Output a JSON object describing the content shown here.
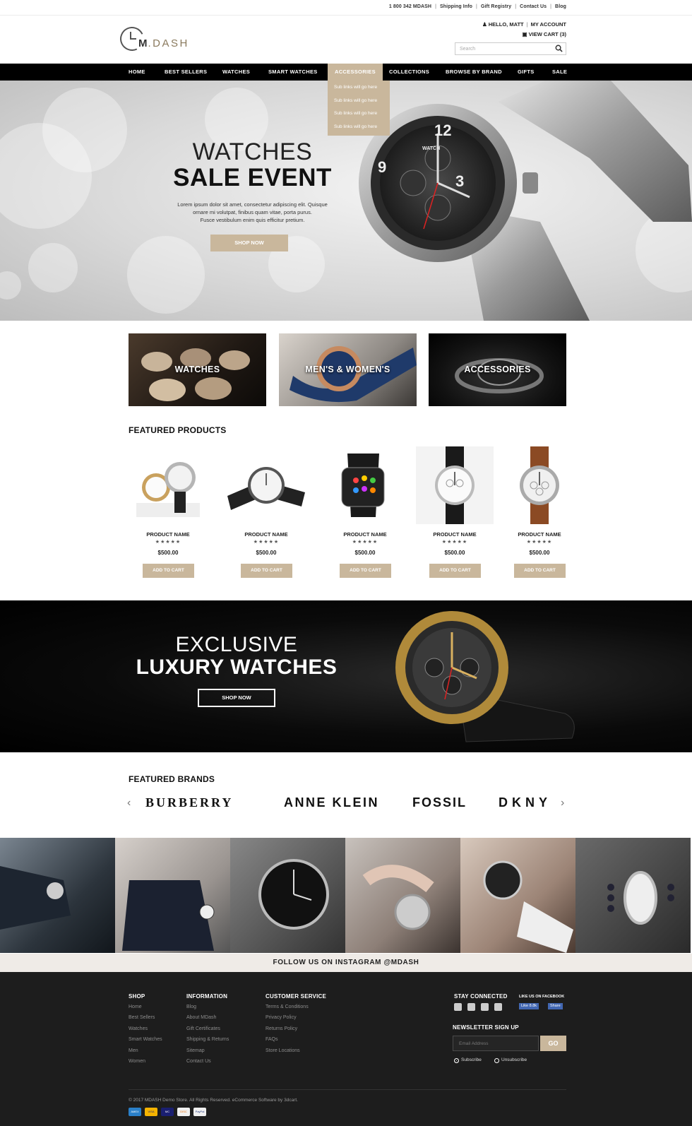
{
  "topbar": {
    "links": [
      "1 800 342 MDASH",
      "Shipping Info",
      "Gift Registry",
      "Contact Us",
      "Blog"
    ]
  },
  "header": {
    "logo_prefix": "M",
    "logo_suffix": ".DASH",
    "greeting": "HELLO, MATT",
    "my_account": "MY ACCOUNT",
    "view_cart": "VIEW CART (3)",
    "search_placeholder": "Search"
  },
  "nav": {
    "items": [
      "HOME",
      "BEST SELLERS",
      "WATCHES",
      "SMART WATCHES",
      "ACCESSORIES",
      "COLLECTIONS",
      "BROWSE BY BRAND",
      "GIFTS",
      "SALE"
    ],
    "active": "ACCESSORIES",
    "dropdown": [
      "Sub links will go here",
      "Sub links will go here",
      "Sub links will go here",
      "Sub links will go here"
    ]
  },
  "hero": {
    "line1": "WATCHES",
    "line2": "SALE EVENT",
    "desc1": "Lorem ipsum dolor sit amet, consectetur adipiscing elit. Quisque",
    "desc2": "ornare mi volutpat, finibus quam vitae, porta purus.",
    "desc3": "Fusce vestibulum enim quis efficitur pretium.",
    "button": "SHOP NOW",
    "watch_face_text": "WATCH"
  },
  "categories": [
    "WATCHES",
    "MEN'S & WOMEN'S",
    "ACCESSORIES"
  ],
  "featured": {
    "title": "FEATURED PRODUCTS",
    "products": [
      {
        "name": "PRODUCT NAME",
        "stars": "★★★★★",
        "price": "$500.00",
        "button": "ADD TO CART"
      },
      {
        "name": "PRODUCT NAME",
        "stars": "★★★★★",
        "price": "$500.00",
        "button": "ADD TO CART"
      },
      {
        "name": "PRODUCT NAME",
        "stars": "★★★★★",
        "price": "$500.00",
        "button": "ADD TO CART"
      },
      {
        "name": "PRODUCT NAME",
        "stars": "★★★★★",
        "price": "$500.00",
        "button": "ADD TO CART"
      },
      {
        "name": "PRODUCT NAME",
        "stars": "★★★★★",
        "price": "$500.00",
        "button": "ADD TO CART"
      }
    ]
  },
  "luxury": {
    "line1": "EXCLUSIVE",
    "line2": "LUXURY WATCHES",
    "button": "SHOP NOW"
  },
  "brands": {
    "title": "FEATURED BRANDS",
    "items": [
      "BURBERRY",
      "ANNE KLEIN",
      "FOSSIL",
      "DKNY"
    ]
  },
  "instagram": {
    "label": "FOLLOW US ON INSTAGRAM @MDASH"
  },
  "footer": {
    "shop": {
      "title": "SHOP",
      "items": [
        "Home",
        "Best Sellers",
        "Watches",
        "Smart Watches",
        "Men",
        "Women"
      ]
    },
    "information": {
      "title": "INFORMATION",
      "items": [
        "Blog",
        "About MDash",
        "Gift Certificates",
        "Shipping & Returns",
        "Sitemap",
        "Contact Us"
      ]
    },
    "service": {
      "title": "CUSTOMER SERVICE",
      "items": [
        "Terms & Conditions",
        "Privacy Policy",
        "Returns Policy",
        "FAQs",
        "Store Locations"
      ]
    },
    "stay_connected": "STAY CONNECTED",
    "like_us": "LIKE US ON FACEBOOK",
    "fb_like": "Like 8.8k",
    "fb_share": "Share",
    "newsletter_title": "NEWSLETTER SIGN UP",
    "email_placeholder": "Email Address",
    "go": "GO",
    "subscribe": "Subscribe",
    "unsubscribe": "Unsubscribe",
    "copyright": "© 2017 MDASH Demo Store. All Rights Reserved. eCommerce Software by 3dcart.",
    "payment_icons": [
      "amex-icon",
      "visa-icon",
      "mastercard-icon",
      "discover-icon",
      "paypal-icon"
    ],
    "payment_labels": [
      "AMEX",
      "VISA",
      "MC",
      "DISC",
      "PayPal"
    ]
  },
  "colors": {
    "accent": "#c9b79c",
    "nav_bg": "#000000",
    "footer_bg": "#1d1d1d",
    "instagram_bar": "#efebe7"
  }
}
